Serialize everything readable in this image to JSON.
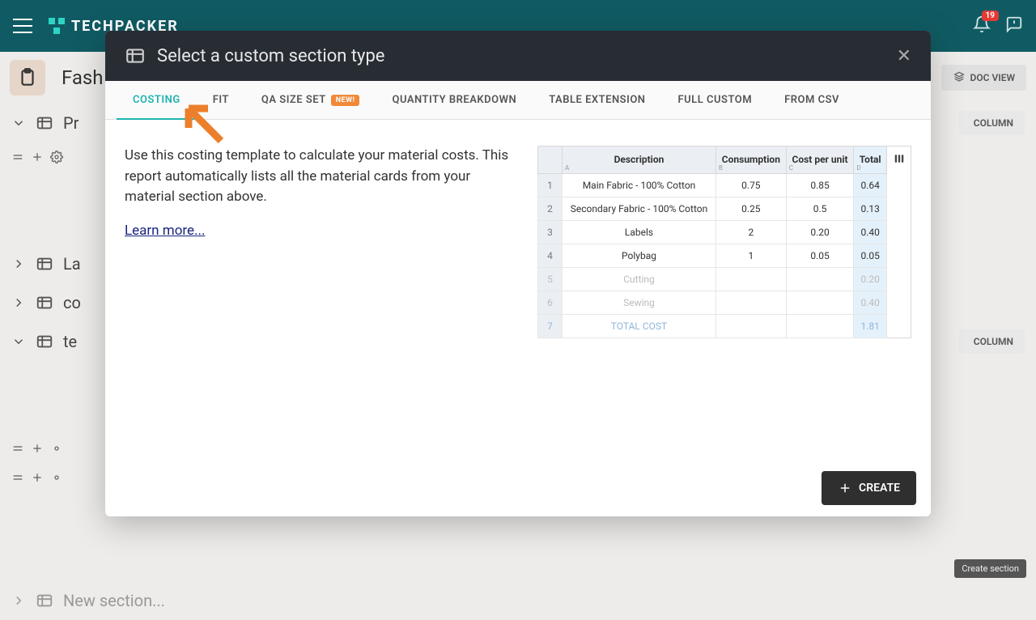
{
  "appbar": {
    "brand": "TECHPACKER",
    "notif_count": "19"
  },
  "page": {
    "title": "Fash",
    "docview": "DOC VIEW",
    "column_btn": "COLUMN",
    "sections": [
      "Pr",
      "La",
      "co",
      "te"
    ],
    "new_section": "New section..."
  },
  "modal": {
    "title": "Select a custom section type",
    "tabs": {
      "costing": "COSTING",
      "fit": "FIT",
      "qa": "QA SIZE SET",
      "new_badge": "NEW!",
      "qty": "QUANTITY BREAKDOWN",
      "ext": "TABLE EXTENSION",
      "custom": "FULL CUSTOM",
      "csv": "FROM CSV"
    },
    "desc": "Use this costing template to calculate your material costs. This report automatically lists all the material cards from your material section above.",
    "learn": "Learn more...",
    "create": "CREATE",
    "tooltip": "Create section",
    "table": {
      "headers": {
        "desc": "Description",
        "cons": "Consumption",
        "cpu": "Cost per unit",
        "total": "Total"
      },
      "rows": [
        {
          "n": "1",
          "d": "Main Fabric - 100% Cotton",
          "c": "0.75",
          "p": "0.85",
          "t": "0.64"
        },
        {
          "n": "2",
          "d": "Secondary Fabric - 100% Cotton",
          "c": "0.25",
          "p": "0.5",
          "t": "0.13"
        },
        {
          "n": "3",
          "d": "Labels",
          "c": "2",
          "p": "0.20",
          "t": "0.40"
        },
        {
          "n": "4",
          "d": "Polybag",
          "c": "1",
          "p": "0.05",
          "t": "0.05"
        },
        {
          "n": "5",
          "d": "Cutting",
          "c": "",
          "p": "",
          "t": "0.20"
        },
        {
          "n": "6",
          "d": "Sewing",
          "c": "",
          "p": "",
          "t": "0.40"
        },
        {
          "n": "7",
          "d": "TOTAL COST",
          "c": "",
          "p": "",
          "t": "1.81"
        }
      ]
    }
  }
}
